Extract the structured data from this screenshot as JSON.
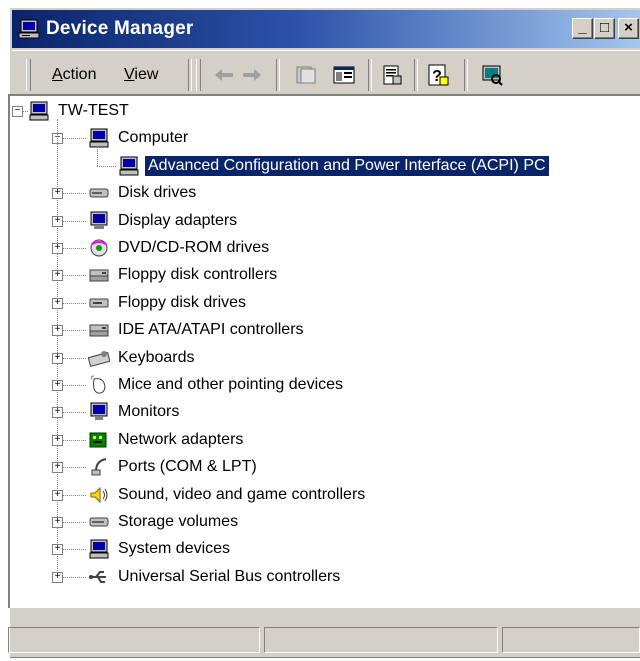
{
  "window": {
    "title": "Device Manager",
    "controls": {
      "minimize": "_",
      "maximize": "□",
      "close": "×"
    }
  },
  "toolbar": {
    "menu": [
      {
        "label": "Action",
        "accel": "A",
        "rest": "ction"
      },
      {
        "label": "View",
        "accel": "V",
        "rest": "iew"
      }
    ],
    "icons": [
      "back-arrow-icon",
      "forward-arrow-icon",
      "up-folder-icon",
      "show-hide-tree-icon",
      "properties-icon",
      "help-icon",
      "scan-hardware-icon"
    ]
  },
  "tree": {
    "root": "TW-TEST",
    "computer": "Computer",
    "selected": "Advanced Configuration and Power Interface (ACPI) PC",
    "categories": [
      {
        "label": "Disk drives",
        "icon": "disk-drive-icon"
      },
      {
        "label": "Display adapters",
        "icon": "display-adapter-icon"
      },
      {
        "label": "DVD/CD-ROM drives",
        "icon": "cdrom-icon"
      },
      {
        "label": "Floppy disk controllers",
        "icon": "controller-icon"
      },
      {
        "label": "Floppy disk drives",
        "icon": "floppy-drive-icon"
      },
      {
        "label": "IDE ATA/ATAPI controllers",
        "icon": "controller-icon"
      },
      {
        "label": "Keyboards",
        "icon": "keyboard-icon"
      },
      {
        "label": "Mice and other pointing devices",
        "icon": "mouse-icon"
      },
      {
        "label": "Monitors",
        "icon": "monitor-icon"
      },
      {
        "label": "Network adapters",
        "icon": "network-adapter-icon"
      },
      {
        "label": "Ports (COM & LPT)",
        "icon": "port-icon"
      },
      {
        "label": "Sound, video and game controllers",
        "icon": "sound-icon"
      },
      {
        "label": "Storage volumes",
        "icon": "storage-volume-icon"
      },
      {
        "label": "System devices",
        "icon": "system-device-icon"
      },
      {
        "label": "Universal Serial Bus controllers",
        "icon": "usb-icon"
      }
    ]
  },
  "colors": {
    "titlebar_start": "#0a246a",
    "titlebar_end": "#a6caf0",
    "selection": "#0a246a",
    "chrome": "#d4d0c8"
  }
}
